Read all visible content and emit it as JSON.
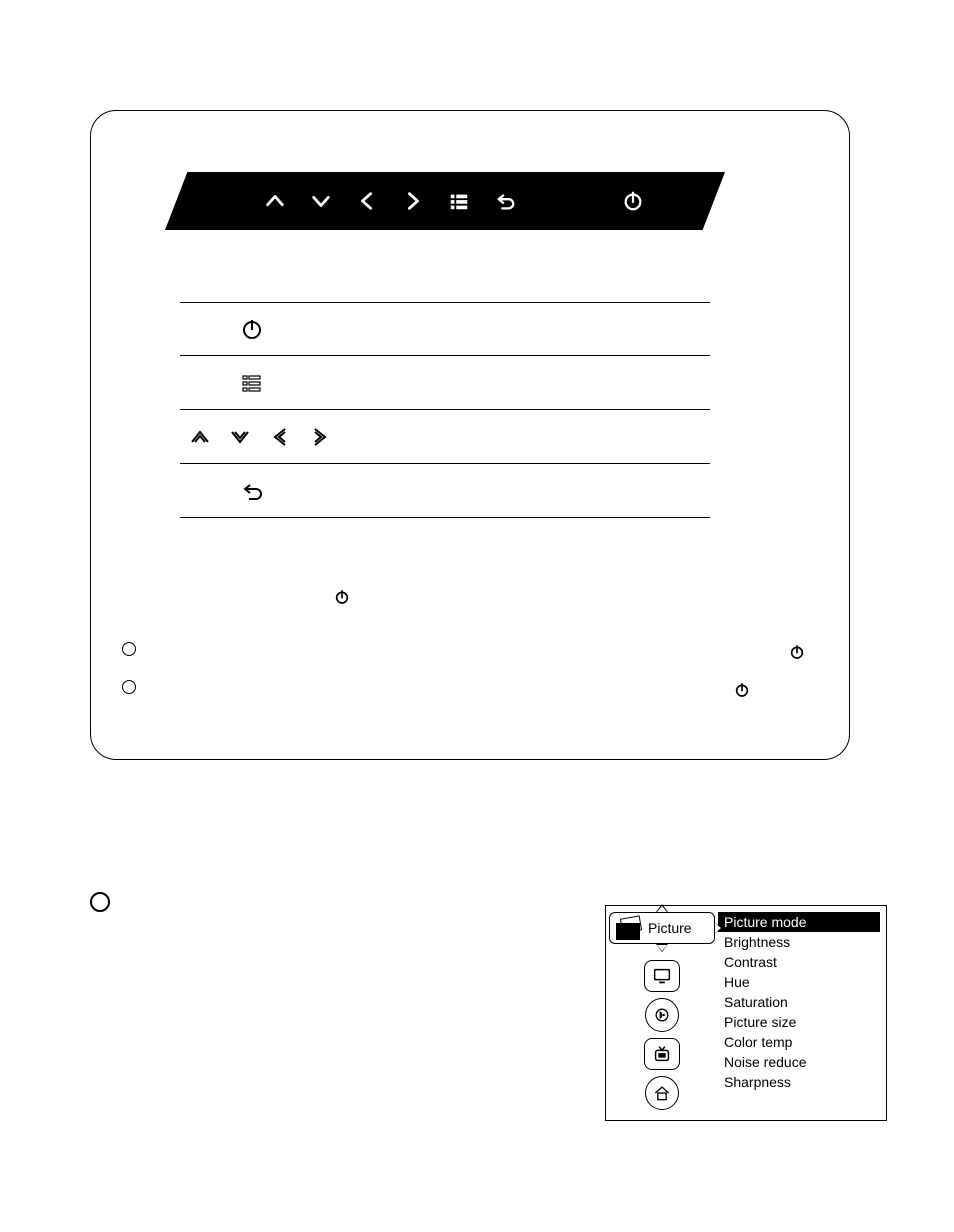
{
  "panel": {
    "top_bar_icons": [
      "up",
      "down",
      "left",
      "right",
      "menu",
      "back",
      "power"
    ],
    "rows": [
      {
        "id": "power",
        "icons": [
          "power"
        ]
      },
      {
        "id": "menu",
        "icons": [
          "menu"
        ]
      },
      {
        "id": "nav",
        "icons": [
          "up",
          "down",
          "left",
          "right"
        ]
      },
      {
        "id": "back",
        "icons": [
          "back"
        ]
      }
    ],
    "note_icon": "power"
  },
  "side_marks": {
    "left_bullets": 2,
    "right_power_icons": 2,
    "lower_left_bullet": true
  },
  "osd": {
    "category_label": "Picture",
    "item_icons": [
      "monitor",
      "sound",
      "tv",
      "home"
    ],
    "list": [
      {
        "label": "Picture mode",
        "selected": true
      },
      {
        "label": "Brightness",
        "selected": false
      },
      {
        "label": "Contrast",
        "selected": false
      },
      {
        "label": "Hue",
        "selected": false
      },
      {
        "label": "Saturation",
        "selected": false
      },
      {
        "label": "Picture size",
        "selected": false
      },
      {
        "label": "Color temp",
        "selected": false
      },
      {
        "label": "Noise reduce",
        "selected": false
      },
      {
        "label": "Sharpness",
        "selected": false
      }
    ]
  }
}
